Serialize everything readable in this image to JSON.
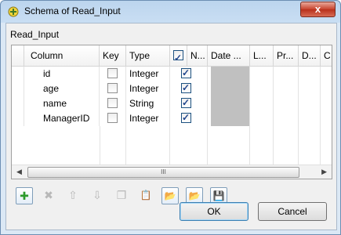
{
  "window": {
    "title": "Schema of Read_Input",
    "close_label": "x"
  },
  "schema_name": "Read_Input",
  "table": {
    "columns": [
      "Column",
      "Key",
      "Type",
      "",
      "N...",
      "Date ...",
      "L...",
      "Pr...",
      "D...",
      "C"
    ],
    "rows": [
      {
        "column": "id",
        "key": false,
        "type": "Integer",
        "nullable": true
      },
      {
        "column": "age",
        "key": false,
        "type": "Integer",
        "nullable": true
      },
      {
        "column": "name",
        "key": false,
        "type": "String",
        "nullable": true
      },
      {
        "column": "ManagerID",
        "key": false,
        "type": "Integer",
        "nullable": true
      }
    ],
    "scroll_thumb": "III"
  },
  "toolbar": {
    "add": "✚",
    "remove": "✖",
    "up": "⇧",
    "down": "⇩",
    "copy": "❐",
    "paste": "📋",
    "import": "📂",
    "export": "📂",
    "save": "💾"
  },
  "buttons": {
    "ok": "OK",
    "cancel": "Cancel"
  }
}
